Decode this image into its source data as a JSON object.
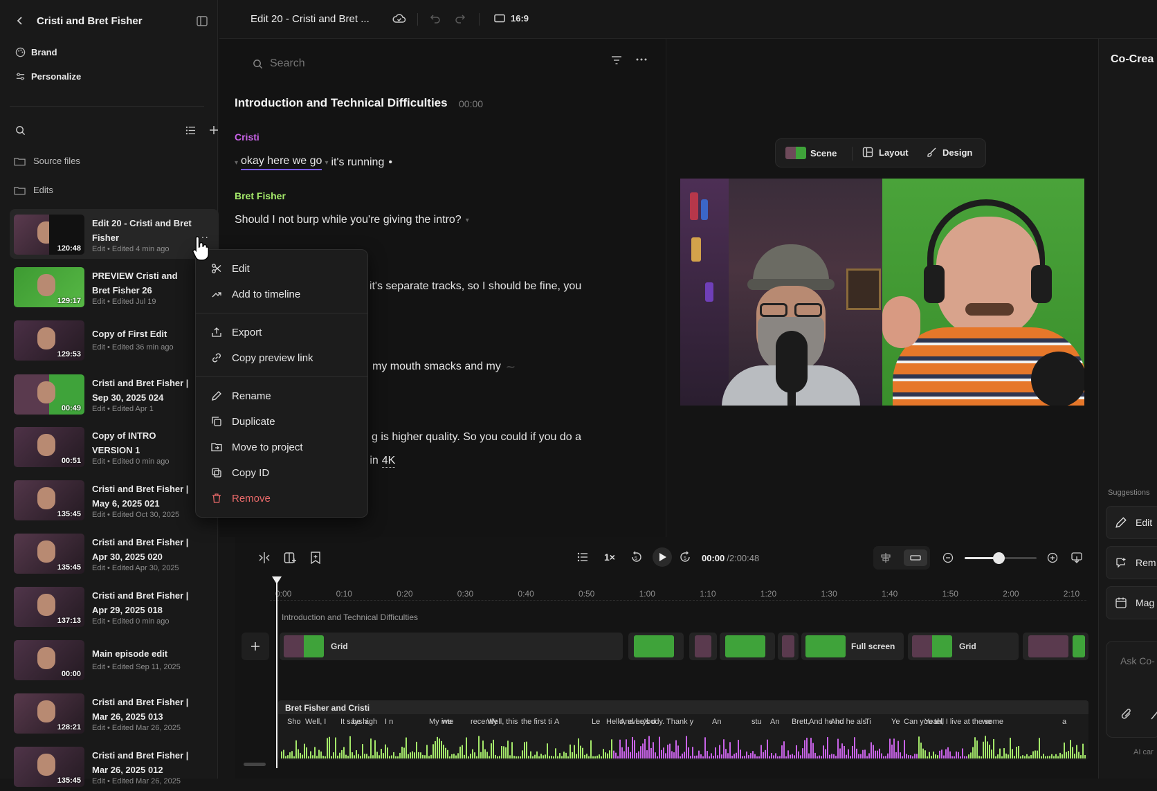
{
  "sidebar": {
    "title": "Cristi and Bret Fisher",
    "nav": [
      {
        "label": "Brand"
      },
      {
        "label": "Personalize"
      }
    ],
    "folders": [
      {
        "label": "Source files"
      },
      {
        "label": "Edits"
      }
    ],
    "edits": [
      {
        "title": "Edit 20 - Cristi and Bret Fisher",
        "meta": "Edit • Edited 4 min ago",
        "duration": "120:48"
      },
      {
        "title": "PREVIEW Cristi and Bret Fisher 26",
        "meta": "Edit • Edited Jul 19",
        "duration": "129:17"
      },
      {
        "title": "Copy of First Edit",
        "meta": "Edit • Edited 36 min ago",
        "duration": "129:53"
      },
      {
        "title": "Cristi and Bret Fisher | Sep 30, 2025 024",
        "meta": "Edit • Edited Apr 1",
        "duration": "00:49"
      },
      {
        "title": "Copy of INTRO VERSION 1",
        "meta": "Edit • Edited 0 min ago",
        "duration": "00:51"
      },
      {
        "title": "Cristi and Bret Fisher | May 6, 2025 021",
        "meta": "Edit • Edited Oct 30, 2025",
        "duration": "135:45"
      },
      {
        "title": "Cristi and Bret Fisher | Apr 30, 2025 020",
        "meta": "Edit • Edited Apr 30, 2025",
        "duration": "135:45"
      },
      {
        "title": "Cristi and Bret Fisher | Apr 29, 2025 018",
        "meta": "Edit • Edited 0 min ago",
        "duration": "137:13"
      },
      {
        "title": "Main episode edit",
        "meta": "Edit • Edited Sep 11, 2025",
        "duration": "00:00"
      },
      {
        "title": "Cristi and Bret Fisher | Mar 26, 2025 013",
        "meta": "Edit • Edited Mar 26, 2025",
        "duration": "128:21"
      },
      {
        "title": "Cristi and Bret Fisher | Mar 26, 2025 012",
        "meta": "Edit • Edited Mar 26, 2025",
        "duration": "135:45"
      }
    ]
  },
  "context_menu": {
    "items": [
      {
        "label": "Edit",
        "icon": "scissors-icon"
      },
      {
        "label": "Add to timeline",
        "icon": "add-to-timeline-icon"
      },
      {
        "label": "Export",
        "icon": "export-icon"
      },
      {
        "label": "Copy preview link",
        "icon": "link-icon"
      },
      {
        "label": "Rename",
        "icon": "pencil-icon"
      },
      {
        "label": "Duplicate",
        "icon": "duplicate-icon"
      },
      {
        "label": "Move to project",
        "icon": "folder-move-icon"
      },
      {
        "label": "Copy ID",
        "icon": "copy-icon"
      },
      {
        "label": "Remove",
        "icon": "trash-icon"
      }
    ]
  },
  "topbar": {
    "title": "Edit 20 - Cristi and Bret ...",
    "aspect": "16:9"
  },
  "transcript": {
    "search_placeholder": "Search",
    "section_title": "Introduction and Technical Difficulties",
    "section_time": "00:00",
    "speaker1": "Cristi",
    "line1a": "okay here we go",
    "line1b": "it's running",
    "speaker2": "Bret Fisher",
    "line2": "Should I not burp while you're giving the intro?",
    "line3": ", it's separate tracks, so I should be fine, you",
    "line4": "my mouth smacks and my",
    "line5": "g is higher quality. So you could if you do a",
    "line6a": "in",
    "line6b": "4K"
  },
  "preview": {
    "tabs": [
      {
        "label": "Scene"
      },
      {
        "label": "Layout"
      },
      {
        "label": "Design"
      }
    ]
  },
  "right_panel": {
    "title": "Co-Crea",
    "suggestions_label": "Suggestions",
    "suggestions": [
      {
        "label": "Edit"
      },
      {
        "label": "Rem"
      },
      {
        "label": "Mag"
      }
    ],
    "ask_placeholder": "Ask Co-",
    "footer": "AI car"
  },
  "playback": {
    "speed": "1×",
    "current": "00:00",
    "total": "/2:00:48",
    "zoom_fraction": 0.47
  },
  "timeline": {
    "ticks": [
      "0:00",
      "0:10",
      "0:20",
      "0:30",
      "0:40",
      "0:50",
      "1:00",
      "1:10",
      "1:20",
      "1:30",
      "1:40",
      "1:50",
      "2:00",
      "2:10"
    ],
    "section_label": "Introduction and Technical Difficulties",
    "clips": [
      {
        "label": "Grid"
      },
      {
        "label": "Full screen"
      },
      {
        "label": "Grid"
      }
    ],
    "audio_track_label": "Bret Fisher and Cristi",
    "audio_words": [
      "Sho",
      "Well, I",
      "It says a",
      "be high",
      "I n",
      "My inte",
      "we",
      "recently",
      "Well, this",
      "the first ti",
      "A",
      "Le",
      "Hello, everybody. Thank y",
      "And he's d",
      "An",
      "stu",
      "An",
      "Brett,",
      "And he ho",
      "And he als",
      "Ti",
      "Ye",
      "Can you tell",
      "Yeah, I live at the some",
      "we",
      "a"
    ]
  },
  "colors": {
    "speaker1": "#c963e8",
    "speaker2": "#a4e86a",
    "remove": "#ea6a6a",
    "accent_underline": "#7a5cff"
  }
}
